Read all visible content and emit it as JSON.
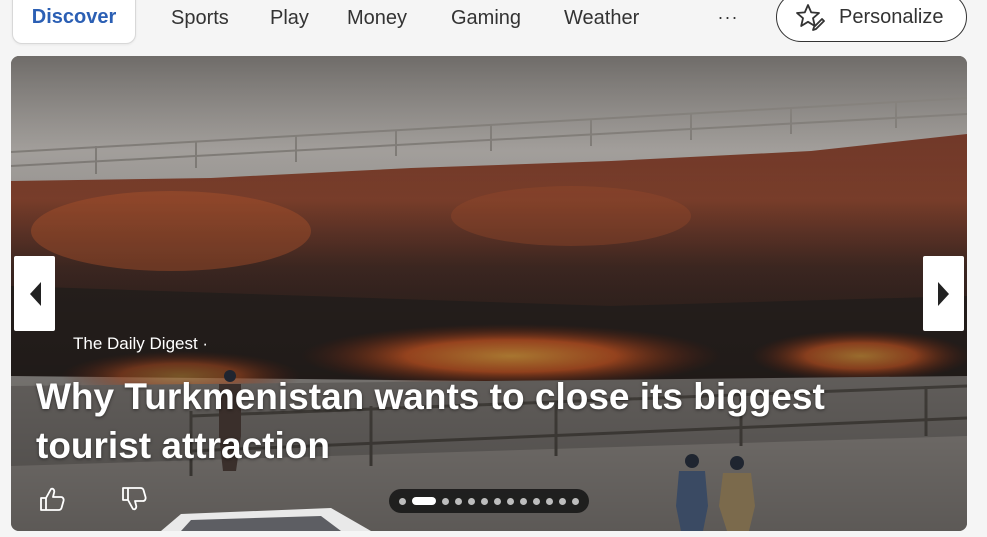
{
  "nav": {
    "tabs": [
      {
        "label": "Discover",
        "active": true
      },
      {
        "label": "Sports"
      },
      {
        "label": "Play"
      },
      {
        "label": "Money"
      },
      {
        "label": "Gaming"
      },
      {
        "label": "Weather"
      }
    ],
    "more_label": "···",
    "personalize_label": "Personalize",
    "personalize_icon": "star-pen-icon"
  },
  "hero": {
    "source": "The Daily Digest ·",
    "headline": "Why Turkmenistan wants to close its biggest tourist attraction",
    "prev_icon": "chevron-left-icon",
    "next_icon": "chevron-right-icon",
    "like_icon": "thumbs-up-icon",
    "dislike_icon": "thumbs-down-icon",
    "carousel": {
      "total": 13,
      "active_index": 1
    }
  },
  "colors": {
    "accent": "#2b5fb4",
    "text": "#333333"
  }
}
